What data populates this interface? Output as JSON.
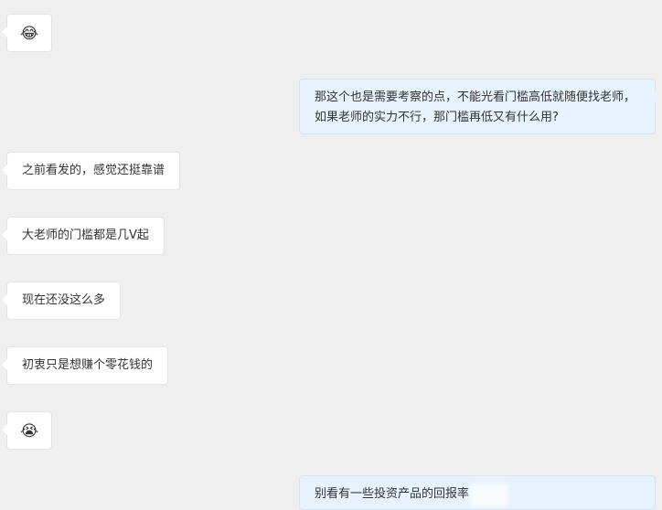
{
  "messages": [
    {
      "side": "left",
      "kind": "emoji",
      "icon": "laughing-face-icon",
      "text": "😂"
    },
    {
      "side": "right",
      "kind": "text",
      "text": "那这个也是需要考察的点，不能光看门槛高低就随便找老师，如果老师的实力不行，那门槛再低又有什么用?"
    },
    {
      "side": "left",
      "kind": "text",
      "text": "之前看发的，感觉还挺靠谱"
    },
    {
      "side": "left",
      "kind": "text",
      "text": "大老师的门槛都是几V起"
    },
    {
      "side": "left",
      "kind": "text",
      "text": "现在还没这么多"
    },
    {
      "side": "left",
      "kind": "text",
      "text": "初衷只是想赚个零花钱的"
    },
    {
      "side": "left",
      "kind": "emoji",
      "icon": "crying-face-icon",
      "text": "😭"
    },
    {
      "side": "right",
      "kind": "text",
      "text": "别看有一些投资产品的回报率"
    }
  ],
  "colors": {
    "background": "#efefef",
    "left_bubble": "#ffffff",
    "right_bubble": "#e7f2fc",
    "text": "#333333"
  }
}
